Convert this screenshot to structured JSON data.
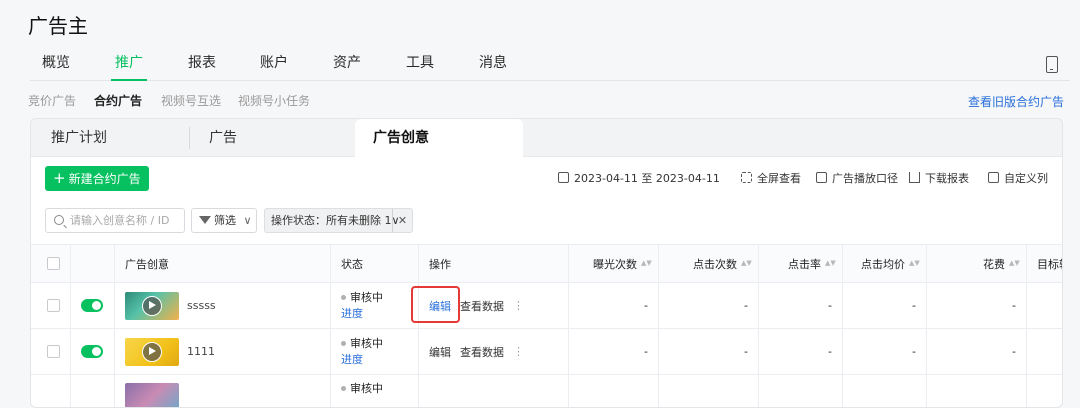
{
  "app": {
    "title": "广告主"
  },
  "main_nav": {
    "tabs": [
      {
        "label": "概览",
        "active": false
      },
      {
        "label": "推广",
        "active": true
      },
      {
        "label": "报表",
        "active": false
      },
      {
        "label": "账户",
        "active": false
      },
      {
        "label": "资产",
        "active": false
      },
      {
        "label": "工具",
        "active": false
      },
      {
        "label": "消息",
        "active": false
      }
    ],
    "device_icon": "mobile-device-icon"
  },
  "sub_nav": {
    "items": [
      {
        "label": "竞价广告",
        "active": false
      },
      {
        "label": "合约广告",
        "active": true
      },
      {
        "label": "视频号互选",
        "active": false
      },
      {
        "label": "视频号小任务",
        "active": false
      }
    ],
    "old_version_link": "查看旧版合约广告"
  },
  "level_tabs": [
    {
      "label": "推广计划",
      "active": false
    },
    {
      "label": "广告",
      "active": false
    },
    {
      "label": "广告创意",
      "active": true
    }
  ],
  "toolbar": {
    "new_button": "新建合约广告",
    "date_range": "2023-04-11 至 2023-04-11",
    "fullscreen": "全屏查看",
    "delivery_caliber": "广告播放口径",
    "download": "下载报表",
    "custom_columns": "自定义列"
  },
  "filters": {
    "search_placeholder": "请输入创意名称 / ID",
    "filter_label": "筛选",
    "status_chip": "操作状态：所有未删除  1∨"
  },
  "table": {
    "columns": [
      "广告创意",
      "状态",
      "操作",
      "曝光次数",
      "点击次数",
      "点击率",
      "点击均价",
      "花费",
      "目标转"
    ],
    "rows": [
      {
        "name": "sssss",
        "status": "审核中",
        "status_link": "进度",
        "actions": [
          "编辑",
          "查看数据"
        ],
        "more": "⋮",
        "metrics": [
          "-",
          "-",
          "-",
          "-",
          "-"
        ],
        "thumb_color": "#2e8b7a"
      },
      {
        "name": "1111",
        "status": "审核中",
        "status_link": "进度",
        "actions": [
          "编辑",
          "查看数据"
        ],
        "more": "⋮",
        "metrics": [
          "-",
          "-",
          "-",
          "-",
          "-"
        ],
        "thumb_color": "#f2c21b"
      },
      {
        "name": "",
        "status": "审核中",
        "status_link": "",
        "actions": [],
        "more": "",
        "metrics": [],
        "thumb_color": "#8a6fa8"
      }
    ]
  },
  "colors": {
    "accent": "#07c160",
    "link": "#2a6fdb",
    "highlight": "#e53935"
  }
}
